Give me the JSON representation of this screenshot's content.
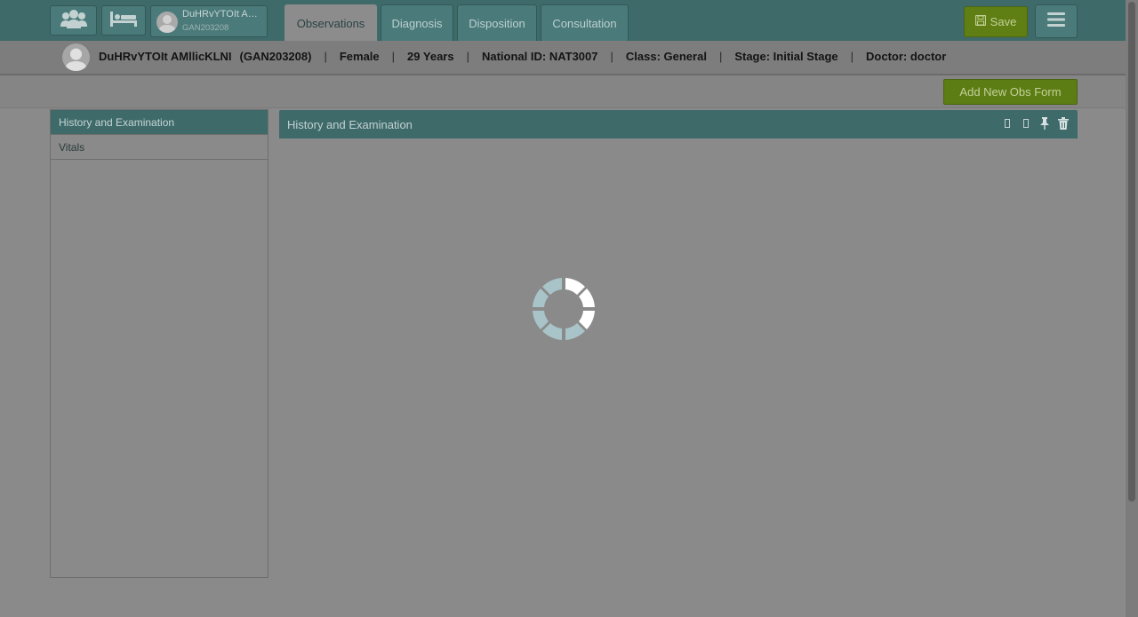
{
  "topbar": {
    "patients_icon": "patients-group-icon",
    "bed_icon": "bed-icon",
    "patient_chip": {
      "name": "DuHRvYTOIt AM...",
      "id": "GAN203208"
    },
    "tabs": [
      {
        "label": "Observations",
        "active": true
      },
      {
        "label": "Diagnosis",
        "active": false
      },
      {
        "label": "Disposition",
        "active": false
      },
      {
        "label": "Consultation",
        "active": false
      }
    ],
    "save_label": "Save",
    "menu_icon": "hamburger-menu-icon"
  },
  "patient_header": {
    "name": "DuHRvYTOIt AMllicKLNI",
    "id": "(GAN203208)",
    "gender": "Female",
    "age": "29 Years",
    "national_id": "National ID: NAT3007",
    "class": "Class: General",
    "stage": "Stage: Initial Stage",
    "doctor": "Doctor: doctor"
  },
  "actions": {
    "add_obs_form": "Add New Obs Form"
  },
  "left_panel": {
    "items": [
      {
        "label": "History and Examination",
        "active": true
      },
      {
        "label": "Vitals",
        "active": false
      }
    ]
  },
  "main_panel": {
    "title": "History and Examination",
    "icons": [
      "expand-icon",
      "collapse-icon",
      "pin-icon",
      "trash-icon"
    ]
  },
  "loading": {
    "spinner_icon": "loading-spinner-icon"
  },
  "colors": {
    "header_teal": "#3f6a6a",
    "save_green": "#5f7f14",
    "overlay_gray": "#8a8a8a"
  }
}
